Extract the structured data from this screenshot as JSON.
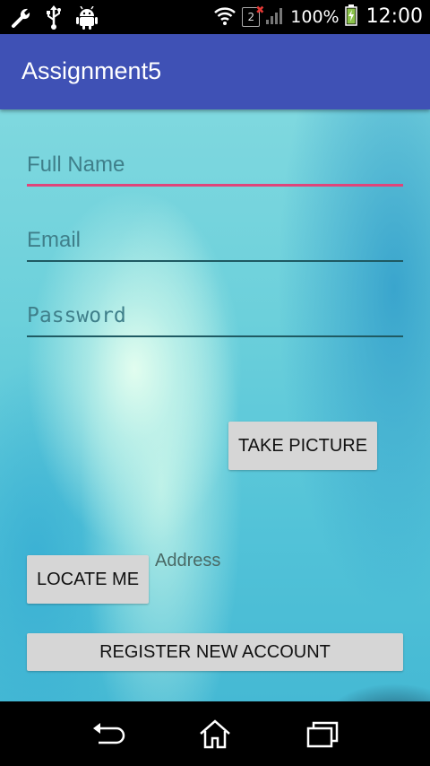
{
  "status_bar": {
    "battery_text": "100%",
    "clock": "12:00",
    "sim_number": "2",
    "icons_left": [
      "wrench-icon",
      "usb-icon",
      "android-icon"
    ],
    "icons_right": [
      "wifi-icon",
      "sim-icon",
      "signal-icon",
      "battery-icon"
    ]
  },
  "app_bar": {
    "title": "Assignment5",
    "color": "#3f51b5"
  },
  "form": {
    "full_name": {
      "placeholder": "Full Name",
      "value": ""
    },
    "email": {
      "placeholder": "Email",
      "value": ""
    },
    "password": {
      "placeholder": "Password",
      "value": ""
    },
    "focus_color": "#e0447a"
  },
  "buttons": {
    "take_picture": "TAKE PICTURE",
    "locate_me": "LOCATE ME",
    "register": "REGISTER NEW ACCOUNT"
  },
  "address_label": "Address",
  "nav_bar": {
    "icons": [
      "back-icon",
      "home-icon",
      "recents-icon"
    ]
  }
}
